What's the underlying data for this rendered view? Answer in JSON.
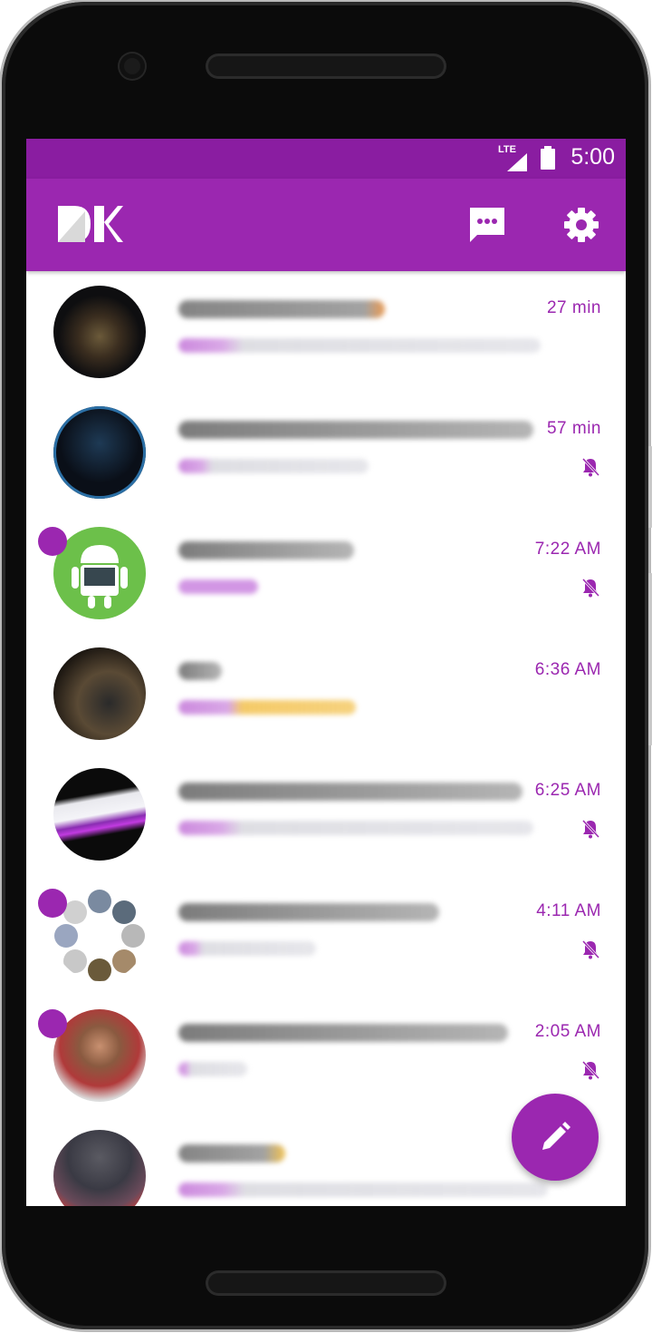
{
  "status_bar": {
    "network_label": "LTE",
    "time": "5:00",
    "icons": [
      "lte-signal-icon",
      "battery-icon"
    ]
  },
  "app_bar": {
    "logo_icon": "dk-logo-icon",
    "actions": [
      {
        "name": "messages",
        "icon": "chat-bubble-icon"
      },
      {
        "name": "settings",
        "icon": "gear-icon"
      }
    ]
  },
  "conversations": [
    {
      "time": "27 min",
      "unread": false,
      "muted": false
    },
    {
      "time": "57 min",
      "unread": false,
      "muted": true
    },
    {
      "time": "7:22 AM",
      "unread": true,
      "muted": true
    },
    {
      "time": "6:36 AM",
      "unread": false,
      "muted": false
    },
    {
      "time": "6:25 AM",
      "unread": false,
      "muted": true
    },
    {
      "time": "4:11 AM",
      "unread": true,
      "muted": true
    },
    {
      "time": "2:05 AM",
      "unread": true,
      "muted": true
    },
    {
      "time": "",
      "unread": false,
      "muted": false
    }
  ],
  "fab": {
    "icon": "pencil-icon"
  },
  "colors": {
    "primary": "#9b27b0",
    "primary_dark": "#8a1da1",
    "background": "#ffffff"
  }
}
